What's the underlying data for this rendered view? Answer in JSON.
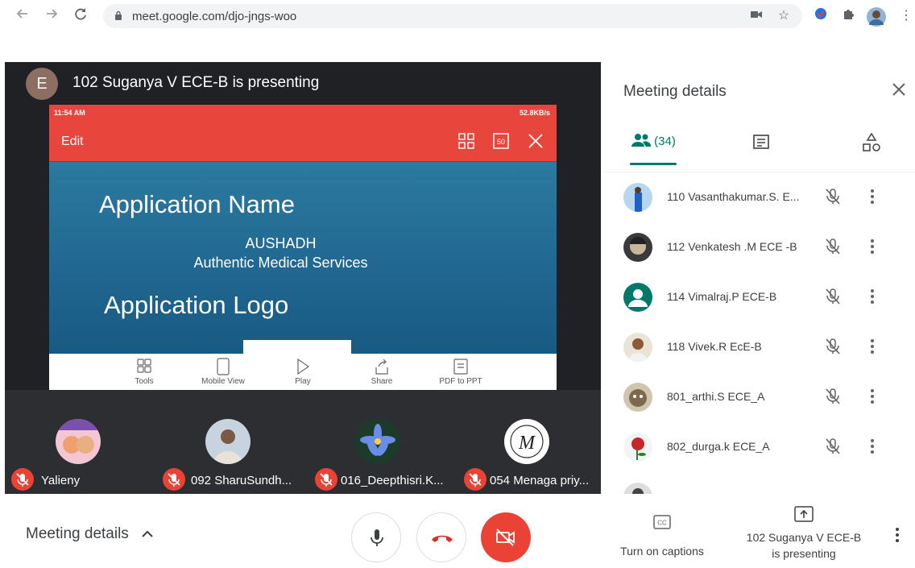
{
  "browser": {
    "url": "meet.google.com/djo-jngs-woo"
  },
  "presenter": {
    "avatar_letter": "E",
    "title": "102 Suganya V ECE-B is presenting"
  },
  "shared_screen": {
    "status_time": "11:54 AM",
    "status_right": "52.8KB/s",
    "edit_label": "Edit",
    "slide_heading1": "Application Name",
    "slide_line1": "AUSHADH",
    "slide_line2": "Authentic Medical Services",
    "slide_heading2": "Application Logo",
    "tools": [
      {
        "label": "Tools",
        "icon": "grid-icon"
      },
      {
        "label": "Mobile View",
        "icon": "phone-icon"
      },
      {
        "label": "Play",
        "icon": "play-icon"
      },
      {
        "label": "Share",
        "icon": "share-icon"
      },
      {
        "label": "PDF to PPT",
        "icon": "pdf-icon"
      }
    ]
  },
  "tiles": [
    {
      "name": "Yalieny"
    },
    {
      "name": "092 SharuSundh..."
    },
    {
      "name": "016_Deepthisri.K..."
    },
    {
      "name": "054 Menaga priy..."
    }
  ],
  "side_panel": {
    "title": "Meeting details",
    "people_count": "(34)",
    "participants": [
      {
        "name": "110 Vasanthakumar.S. E..."
      },
      {
        "name": "112 Venkatesh .M ECE -B"
      },
      {
        "name": "114 Vimalraj.P ECE-B"
      },
      {
        "name": "118 Vivek.R EcE-B"
      },
      {
        "name": "801_arthi.S ECE_A"
      },
      {
        "name": "802_durga.k ECE_A"
      }
    ]
  },
  "bottom_bar": {
    "meeting_details": "Meeting details",
    "captions_label": "Turn on captions",
    "presenting_line1": "102 Suganya V ECE-B",
    "presenting_line2": "is presenting"
  },
  "colors": {
    "accent_teal": "#00796b",
    "hangup_red": "#ea4335",
    "app_red": "#e8453c",
    "stage_dark": "#202124"
  }
}
